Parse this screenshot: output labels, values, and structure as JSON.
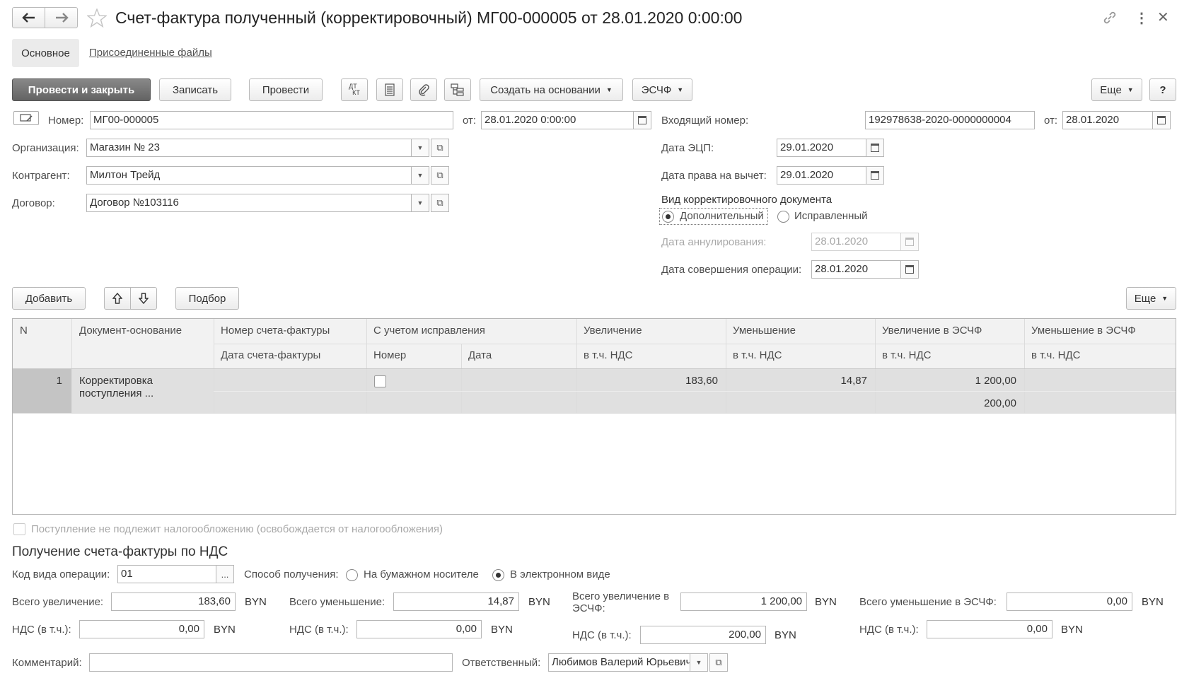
{
  "header": {
    "title": "Счет-фактура полученный (корректировочный) МГ00-000005 от 28.01.2020 0:00:00"
  },
  "tabs": [
    {
      "label": "Основное"
    },
    {
      "label": "Присоединенные файлы"
    }
  ],
  "toolbar": {
    "post_close": "Провести и закрыть",
    "save": "Записать",
    "post": "Провести",
    "dtkt": "ДТ КТ",
    "create_basis": "Создать на основании",
    "esf": "ЭСЧФ",
    "more": "Еще",
    "help": "?"
  },
  "form": {
    "number_label": "Номер:",
    "number_value": "МГ00-000005",
    "from_label": "от:",
    "date_value": "28.01.2020  0:00:00",
    "incoming_label": "Входящий номер:",
    "incoming_value": "192978638-2020-0000000004",
    "incoming_from_label": "от:",
    "incoming_date": "28.01.2020",
    "org_label": "Организация:",
    "org_value": "Магазин № 23",
    "contractor_label": "Контрагент:",
    "contractor_value": "Милтон Трейд",
    "contract_label": "Договор:",
    "contract_value": "Договор №103116",
    "ecp_label": "Дата ЭЦП:",
    "ecp_value": "29.01.2020",
    "deduct_label": "Дата права на вычет:",
    "deduct_value": "29.01.2020",
    "kind_label": "Вид корректировочного документа",
    "kind_opt1": "Дополнительный",
    "kind_opt2": "Исправленный",
    "annul_label": "Дата аннулирования:",
    "annul_value": "28.01.2020",
    "op_date_label": "Дата совершения операции:",
    "op_date_value": "28.01.2020"
  },
  "table_toolbar": {
    "add": "Добавить",
    "pick": "Подбор",
    "more": "Еще"
  },
  "table": {
    "headers": {
      "n": "N",
      "doc": "Документ-основание",
      "inv_num": "Номер счета-фактуры",
      "inv_date": "Дата счета-фактуры",
      "corr": "С учетом исправления",
      "corr_num": "Номер",
      "corr_date": "Дата",
      "inc": "Увеличение",
      "inc_vat": "в т.ч. НДС",
      "dec": "Уменьшение",
      "dec_vat": "в т.ч. НДС",
      "inc_esf": "Увеличение в ЭСЧФ",
      "inc_esf_vat": "в т.ч. НДС",
      "dec_esf": "Уменьшение  в ЭСЧФ",
      "dec_esf_vat": "в т.ч. НДС"
    },
    "rows": [
      {
        "n": "1",
        "doc": "Корректировка поступления ...",
        "inc": "183,60",
        "dec": "14,87",
        "inc_esf": "1 200,00",
        "inc_esf_vat": "200,00"
      }
    ]
  },
  "bottom": {
    "exempt_label": "Поступление не подлежит налогообложению (освобождается от налогообложения)",
    "section_title": "Получение счета-фактуры по НДС",
    "op_code_label": "Код вида операции:",
    "op_code_value": "01",
    "receipt_label": "Способ получения:",
    "receipt_paper": "На бумажном носителе",
    "receipt_electronic": "В электронном виде",
    "total_inc_label": "Всего увеличение:",
    "total_inc_value": "183,60",
    "total_dec_label": "Всего уменьшение:",
    "total_dec_value": "14,87",
    "total_inc_esf_label": "Всего увеличение в ЭСЧФ:",
    "total_inc_esf_value": "1 200,00",
    "total_dec_esf_label": "Всего уменьшение в ЭСЧФ:",
    "total_dec_esf_value": "0,00",
    "vat_label": "НДС (в т.ч.):",
    "vat_inc_value": "0,00",
    "vat_dec_value": "0,00",
    "vat_inc_esf_value": "200,00",
    "vat_dec_esf_value": "0,00",
    "currency": "BYN",
    "comment_label": "Комментарий:",
    "comment_value": "",
    "responsible_label": "Ответственный:",
    "responsible_value": "Любимов Валерий Юрьевич"
  }
}
